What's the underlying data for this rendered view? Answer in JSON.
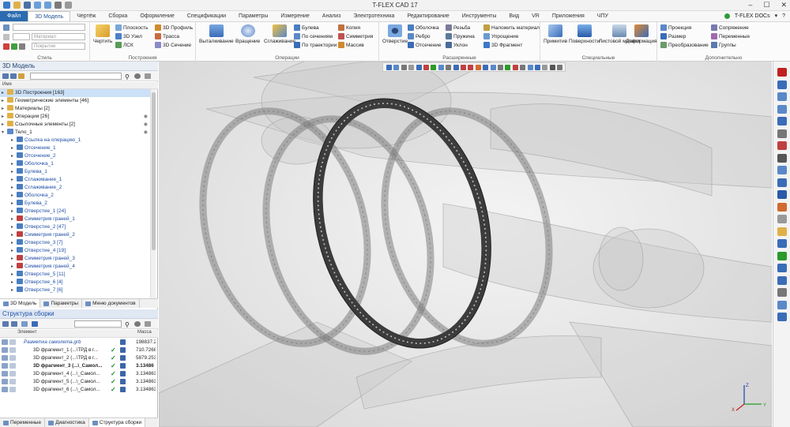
{
  "app": {
    "title": "T-FLEX CAD 17",
    "docs_label": "T-FLEX DOCs"
  },
  "menu": {
    "tabs": [
      "Файл",
      "3D Модель",
      "Чертёж",
      "Сборка",
      "Оформление",
      "Спецификации",
      "Параметры",
      "Измерение",
      "Анализ",
      "Электротехника",
      "Редактирование",
      "Инструменты",
      "Вид",
      "VR",
      "Приложения",
      "ЧПУ"
    ],
    "active": "3D Модель"
  },
  "ribbon": {
    "style_group": {
      "label": "Стиль",
      "material_placeholder": "Материал",
      "coating_placeholder": "Покрытие"
    },
    "constructions": {
      "label": "Построения",
      "draw_label": "Чертить",
      "items": [
        "Плоскость",
        "3D Узел",
        "ЛСК",
        "3D Профиль",
        "Трасса",
        "3D Сечение"
      ]
    },
    "operations": {
      "label": "Операции",
      "big": [
        "Выталкивание",
        "Вращение",
        "Сглаживание"
      ],
      "items": [
        "Булева",
        "По сечениям",
        "По траектории",
        "Копия",
        "Симметрия",
        "Массив"
      ]
    },
    "extended": {
      "label": "Расширенные",
      "big": [
        "Отверстие"
      ],
      "items": [
        "Оболочка",
        "Ребро",
        "Отсечение",
        "Резьба",
        "Пружина",
        "Уклон",
        "Наложить материал",
        "Упрощение",
        "3D Фрагмент"
      ]
    },
    "special": {
      "label": "Специальные",
      "big": [
        "Примитив",
        "Поверхности",
        "Листовой металл",
        "Деформация"
      ]
    },
    "additional": {
      "label": "Дополнительно",
      "items": [
        "Проекция",
        "Размер",
        "Преобразование",
        "Сопряжение",
        "Переменные",
        "Группы"
      ]
    }
  },
  "model_panel": {
    "title": "3D Модель",
    "column": "Имя",
    "tree": [
      {
        "label": "3D Построения [163]",
        "level": 0,
        "kind": "folder",
        "selected": true
      },
      {
        "label": "Геометрические элементы [46]",
        "level": 0,
        "kind": "folder"
      },
      {
        "label": "Материалы [2]",
        "level": 0,
        "kind": "folder"
      },
      {
        "label": "Операции [26]",
        "level": 0,
        "kind": "folder",
        "eye": true
      },
      {
        "label": "Ссылочные элементы [2]",
        "level": 0,
        "kind": "folder",
        "eye": true
      },
      {
        "label": "Тело_1",
        "level": 0,
        "kind": "body",
        "eye": true,
        "expanded": true
      },
      {
        "label": "Ссылка на операцию_1",
        "level": 1,
        "kind": "op"
      },
      {
        "label": "Отсечение_1",
        "level": 1,
        "kind": "op"
      },
      {
        "label": "Отсечение_2",
        "level": 1,
        "kind": "op"
      },
      {
        "label": "Оболочка_1",
        "level": 1,
        "kind": "op"
      },
      {
        "label": "Булева_1",
        "level": 1,
        "kind": "op"
      },
      {
        "label": "Сглаживание_1",
        "level": 1,
        "kind": "op"
      },
      {
        "label": "Сглаживание_2",
        "level": 1,
        "kind": "op"
      },
      {
        "label": "Оболочка_2",
        "level": 1,
        "kind": "op"
      },
      {
        "label": "Булева_2",
        "level": 1,
        "kind": "op"
      },
      {
        "label": "Отверстие_1 [24]",
        "level": 1,
        "kind": "op"
      },
      {
        "label": "Симметрия граней_1",
        "level": 1,
        "kind": "sym"
      },
      {
        "label": "Отверстие_2 [47]",
        "level": 1,
        "kind": "op"
      },
      {
        "label": "Симметрия граней_2",
        "level": 1,
        "kind": "sym"
      },
      {
        "label": "Отверстие_3 [7]",
        "level": 1,
        "kind": "op"
      },
      {
        "label": "Отверстие_4 [19]",
        "level": 1,
        "kind": "op"
      },
      {
        "label": "Симметрия граней_3",
        "level": 1,
        "kind": "sym"
      },
      {
        "label": "Симметрия граней_4",
        "level": 1,
        "kind": "sym"
      },
      {
        "label": "Отверстие_5 [11]",
        "level": 1,
        "kind": "op"
      },
      {
        "label": "Отверстие_6 [4]",
        "level": 1,
        "kind": "op"
      },
      {
        "label": "Отверстие_7 [6]",
        "level": 1,
        "kind": "op"
      }
    ],
    "tabs": [
      "3D Модель",
      "Параметры",
      "Меню документов"
    ]
  },
  "assembly_panel": {
    "title": "Структура сборки",
    "columns": [
      "Элемент",
      "Масса"
    ],
    "rows": [
      {
        "name": "Разметка самолета.grb",
        "mass": "198837.2",
        "root": true
      },
      {
        "name": "3D фрагмент_1 (...\\ТРД в г...",
        "mass": "710.7268"
      },
      {
        "name": "3D фрагмент_2 (...\\ТРД в г...",
        "mass": "5879.253"
      },
      {
        "name": "3D фрагмент_3 (...\\_Самол...",
        "mass": "3.13486",
        "bold": true
      },
      {
        "name": "3D фрагмент_4 (...\\_Самол...",
        "mass": "3.134863"
      },
      {
        "name": "3D фрагмент_5 (...\\_Самол...",
        "mass": "3.134863"
      },
      {
        "name": "3D фрагмент_6 (...\\_Самол...",
        "mass": "3.134863"
      }
    ],
    "tabs": [
      "Переменные",
      "Диагностика",
      "Структура сборки"
    ]
  },
  "viewport": {
    "axes": {
      "x": "X",
      "y": "Y",
      "z": "Z"
    }
  },
  "colors": {
    "accent": "#2b6cb0",
    "selection": "#cce0f8",
    "viewport_bg": "#e8e8e8"
  }
}
